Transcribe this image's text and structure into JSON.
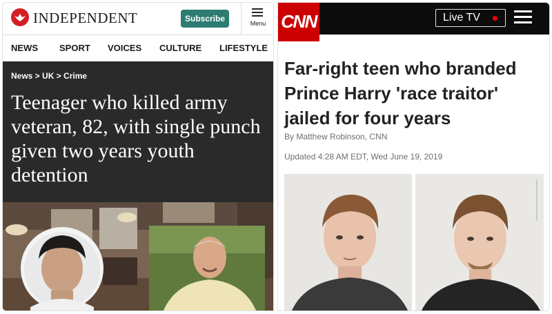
{
  "independent": {
    "logo_text": "INDEPENDENT",
    "subscribe_label": "Subscribe",
    "menu_label": "Menu",
    "nav": [
      "NEWS",
      "SPORT",
      "VOICES",
      "CULTURE",
      "LIFESTYLE"
    ],
    "breadcrumb": "News > UK > Crime",
    "headline": "Teenager who killed army veteran, 82, with single punch given two years youth detention",
    "colors": {
      "brand_red": "#d21f26",
      "subscribe_green": "#2d7c72",
      "hero_bg": "#2a2a2a"
    },
    "icons": [
      "independent-eagle-logo-icon",
      "hamburger-menu-icon"
    ]
  },
  "cnn": {
    "logo_text": "CNN",
    "live_label": "Live TV",
    "headline": "Far-right teen who branded Prince Harry 'race traitor' jailed for four years",
    "byline": "By Matthew Robinson, CNN",
    "updated": "Updated 4:28 AM EDT, Wed June 19, 2019",
    "colors": {
      "brand_red": "#cc0000",
      "header_bg": "#0c0c0c",
      "live_dot": "#ee0000"
    },
    "icons": [
      "live-dot-icon",
      "hamburger-menu-icon"
    ]
  }
}
